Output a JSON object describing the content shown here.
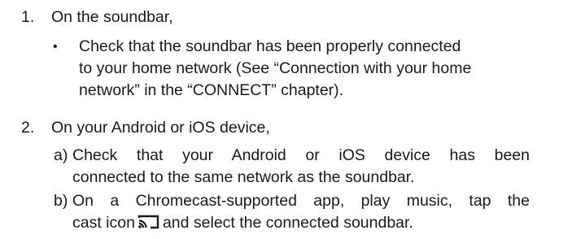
{
  "step1": {
    "number": "1.",
    "heading": "On the soundbar,",
    "bullet": "•",
    "lines": [
      "Check that the soundbar has been properly connected",
      "to your home network (See “Connection with your home",
      "network” in the “CONNECT” chapter)."
    ]
  },
  "step2": {
    "number": "2.",
    "heading": "On your Android or iOS device,",
    "items": [
      {
        "label": "a)",
        "lines": [
          "Check that your Android or iOS device has been",
          "connected to the same network as the soundbar."
        ]
      },
      {
        "label": "b)",
        "line1": "On a Chromecast-supported app, play music, tap the",
        "line2_before": "cast icon",
        "line2_after": "and select the connected soundbar.",
        "icon": "cast-icon"
      }
    ]
  }
}
